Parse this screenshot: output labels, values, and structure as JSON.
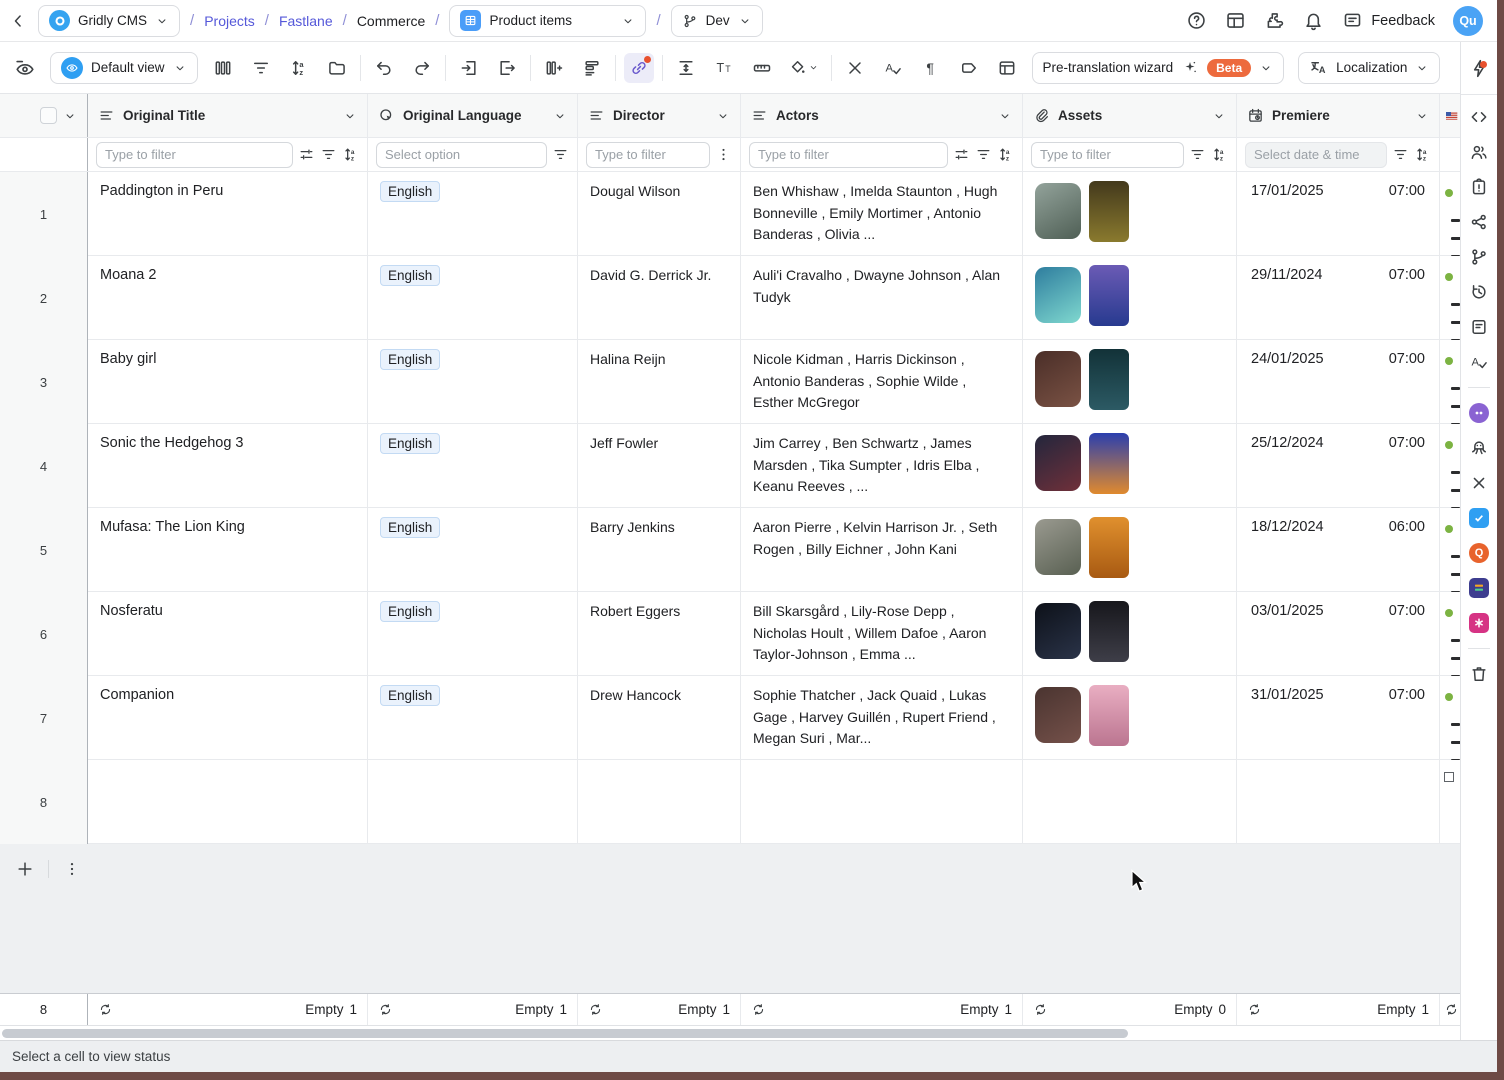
{
  "topbar": {
    "app": "Gridly CMS",
    "breadcrumb": {
      "projects": "Projects",
      "fastlane": "Fastlane",
      "commerce": "Commerce"
    },
    "grid": "Product items",
    "branch": "Dev",
    "feedback": "Feedback",
    "avatar": "Qu"
  },
  "toolbar": {
    "view": "Default view",
    "pretranslation": "Pre-translation wizard",
    "beta": "Beta",
    "localization": "Localization",
    "icon_groups": [
      [
        "columns-icon",
        "funnel-icon",
        "sort-icon",
        "folder-icon"
      ],
      [
        "undo-icon",
        "redo-icon"
      ],
      [
        "import-icon",
        "export-icon"
      ],
      [
        "insert-column-icon",
        "insert-row-icon"
      ],
      [
        "link-icon"
      ],
      [
        "row-height-icon",
        "text-size-icon",
        "ruler-icon",
        "paint-icon"
      ],
      [
        "clear-format-icon",
        "spellcheck-icon",
        "pilcrow-icon",
        "tag-icon",
        "panel-icon"
      ]
    ]
  },
  "table": {
    "columns": [
      {
        "label": "Original Title",
        "icon": "text-column-icon",
        "filter": {
          "type": "input",
          "placeholder": "Type to filter",
          "icons": [
            "sliders-icon",
            "funnel-icon",
            "sort-icon"
          ]
        }
      },
      {
        "label": "Original Language",
        "icon": "select-column-icon",
        "filter": {
          "type": "input",
          "placeholder": "Select option",
          "icons": [
            "funnel-icon"
          ]
        }
      },
      {
        "label": "Director",
        "icon": "text-column-icon",
        "filter": {
          "type": "input",
          "placeholder": "Type to filter",
          "icons": [
            "kebab-icon"
          ]
        }
      },
      {
        "label": "Actors",
        "icon": "text-column-icon",
        "filter": {
          "type": "input",
          "placeholder": "Type to filter",
          "icons": [
            "sliders-icon",
            "funnel-icon",
            "sort-icon"
          ]
        }
      },
      {
        "label": "Assets",
        "icon": "paperclip-icon",
        "filter": {
          "type": "input",
          "placeholder": "Type to filter",
          "icons": [
            "funnel-icon",
            "sort-icon"
          ]
        }
      },
      {
        "label": "Premiere",
        "icon": "calendar-icon",
        "filter": {
          "type": "date",
          "placeholder": "Select date & time",
          "icons": [
            "funnel-icon",
            "sort-icon"
          ]
        }
      }
    ],
    "rows": [
      {
        "num": "1",
        "title": "Paddington in Peru",
        "language": "English",
        "director": "Dougal Wilson",
        "actors": "Ben Whishaw , Imelda Staunton , Hugh Bonneville , Emily Mortimer , Antonio Banderas , Olivia ...",
        "date": "17/01/2025",
        "time": "07:00",
        "thumbs": [
          [
            "#93a39b",
            "#4f5f55"
          ],
          [
            "#43391c",
            "#8a7a2e"
          ]
        ]
      },
      {
        "num": "2",
        "title": "Moana 2",
        "language": "English",
        "director": "David G. Derrick Jr.",
        "actors": "Auli'i Cravalho , Dwayne Johnson , Alan Tudyk",
        "date": "29/11/2024",
        "time": "07:00",
        "thumbs": [
          [
            "#2e7d9e",
            "#7fd8cf"
          ],
          [
            "#6b5bb5",
            "#273a8f"
          ]
        ]
      },
      {
        "num": "3",
        "title": "Baby girl",
        "language": "English",
        "director": "Halina Reijn",
        "actors": "Nicole Kidman , Harris Dickinson , Antonio Banderas , Sophie Wilde , Esther McGregor",
        "date": "24/01/2025",
        "time": "07:00",
        "thumbs": [
          [
            "#4a2e28",
            "#7a5244"
          ],
          [
            "#123238",
            "#2c5a64"
          ]
        ]
      },
      {
        "num": "4",
        "title": "Sonic the Hedgehog 3",
        "language": "English",
        "director": "Jeff Fowler",
        "actors": "Jim Carrey , Ben Schwartz , James Marsden , Tika Sumpter , Idris Elba , Keanu Reeves , ...",
        "date": "25/12/2024",
        "time": "07:00",
        "thumbs": [
          [
            "#23263c",
            "#70303a"
          ],
          [
            "#2b3fae",
            "#e08a2e"
          ]
        ]
      },
      {
        "num": "5",
        "title": "Mufasa: The Lion King",
        "language": "English",
        "director": "Barry Jenkins",
        "actors": "Aaron Pierre , Kelvin Harrison Jr. , Seth Rogen , Billy Eichner , John Kani",
        "date": "18/12/2024",
        "time": "06:00",
        "thumbs": [
          [
            "#9a9a90",
            "#596052"
          ],
          [
            "#e0902e",
            "#a85a12"
          ]
        ]
      },
      {
        "num": "6",
        "title": "Nosferatu",
        "language": "English",
        "director": "Robert Eggers",
        "actors": "Bill Skarsgård , Lily-Rose Depp , Nicholas Hoult , Willem Dafoe , Aaron Taylor-Johnson , Emma ...",
        "date": "03/01/2025",
        "time": "07:00",
        "thumbs": [
          [
            "#0d1119",
            "#2a3348"
          ],
          [
            "#17171c",
            "#3e3e48"
          ]
        ]
      },
      {
        "num": "7",
        "title": "Companion",
        "language": "English",
        "director": "Drew Hancock",
        "actors": "Sophie Thatcher , Jack Quaid , Lukas Gage , Harvey Guillén , Rupert Friend , Megan Suri , Mar...",
        "date": "31/01/2025",
        "time": "07:00",
        "thumbs": [
          [
            "#4a3430",
            "#75514a"
          ],
          [
            "#e9aec2",
            "#bb7590"
          ]
        ]
      }
    ],
    "empty_row_num": "8",
    "footer": {
      "row_count": "8",
      "empty_label": "Empty",
      "counts": [
        "1",
        "1",
        "1",
        "1",
        "0",
        "1"
      ]
    }
  },
  "sidebar": {
    "top_icon": "flash-icon",
    "icons": [
      {
        "name": "code-icon"
      },
      {
        "name": "members-icon"
      },
      {
        "name": "tasks-icon"
      },
      {
        "name": "share-icon"
      },
      {
        "name": "branch-icon"
      },
      {
        "name": "history-icon"
      },
      {
        "name": "notes-icon"
      },
      {
        "name": "spellcheck-icon"
      },
      {
        "type": "divider"
      },
      {
        "name": "bot-icon",
        "style": "app round",
        "color": "#8a63d2"
      },
      {
        "name": "octopus-icon"
      },
      {
        "name": "close-icon"
      },
      {
        "name": "app-check-icon",
        "style": "app",
        "color": "#2f9ff2"
      },
      {
        "name": "app-q-icon",
        "style": "app round",
        "color": "#e8632c",
        "glyph": "Q"
      },
      {
        "name": "app-locale-icon",
        "style": "app",
        "color": "#3d3d8f"
      },
      {
        "name": "app-flower-icon",
        "style": "app",
        "color": "#d63384"
      },
      {
        "type": "divider"
      },
      {
        "name": "trash-icon"
      }
    ]
  },
  "statusbar": {
    "text": "Select a cell to view status"
  },
  "colors": {
    "accent_blue": "#2f9ff2",
    "beta_orange": "#ed6a3d",
    "link_purple": "#5558d9",
    "status_green": "#7cb342",
    "chip_bg": "#eaf2fc",
    "chip_border": "#c3daf3",
    "frame_maroon": "#6e4a45"
  }
}
